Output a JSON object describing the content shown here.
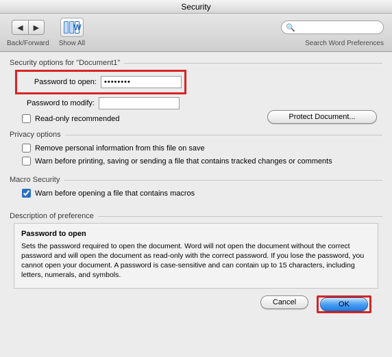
{
  "window": {
    "title": "Security"
  },
  "toolbar": {
    "back_forward_label": "Back/Forward",
    "show_all_label": "Show All",
    "search_placeholder": "",
    "search_label": "Search Word Preferences"
  },
  "security": {
    "section_label": "Security options for \"Document1\"",
    "password_open_label": "Password to open:",
    "password_open_value": "••••••••",
    "password_modify_label": "Password to modify:",
    "password_modify_value": "",
    "readonly_label": "Read-only recommended",
    "readonly_checked": false,
    "protect_button": "Protect Document..."
  },
  "privacy": {
    "section_label": "Privacy options",
    "remove_pi_label": "Remove personal information from this file on save",
    "remove_pi_checked": false,
    "warn_tracked_label": "Warn before printing, saving or sending a file that contains tracked changes or comments",
    "warn_tracked_checked": false
  },
  "macro": {
    "section_label": "Macro Security",
    "warn_macros_label": "Warn before opening a file that contains macros",
    "warn_macros_checked": true
  },
  "description": {
    "section_label": "Description of preference",
    "title": "Password to open",
    "body": "Sets the password required to open the document. Word will not open the document without the correct password and will open the document as read-only with the correct password. If you lose the password, you cannot open your document. A password is case-sensitive and can contain up to 15 characters, including letters, numerals, and symbols."
  },
  "footer": {
    "cancel": "Cancel",
    "ok": "OK"
  }
}
